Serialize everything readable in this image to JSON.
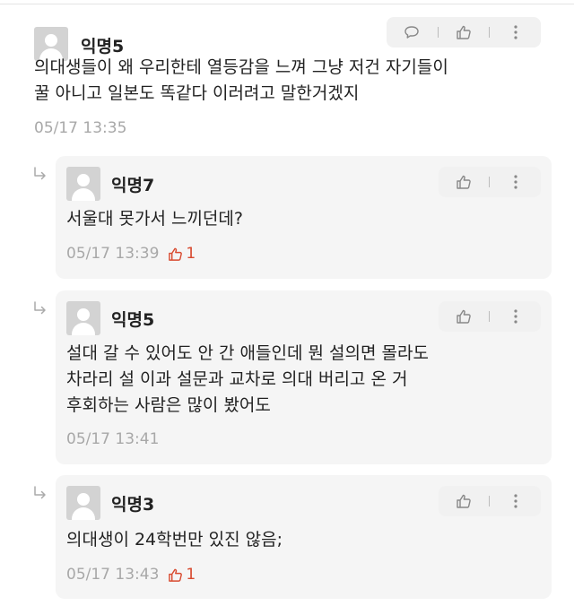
{
  "comment": {
    "author": "익명5",
    "lines": [
      "의대생들이 왜 우리한테 열등감을 느껴 그냥 저건 자기들이",
      "꿀 아니고 일본도 똑같다 이러려고 말한거겠지"
    ],
    "timestamp": "05/17 13:35"
  },
  "replies": [
    {
      "author": "익명7",
      "lines": [
        "서울대 못가서 느끼던데?"
      ],
      "timestamp": "05/17 13:39",
      "likes": "1"
    },
    {
      "author": "익명5",
      "lines": [
        "설대 갈 수 있어도 안 간 애들인데 뭔 설의면 몰라도",
        "차라리 설 이과 설문과 교차로 의대 버리고 온 거",
        "후회하는 사람은 많이 봤어도"
      ],
      "timestamp": "05/17 13:41"
    },
    {
      "author": "익명3",
      "lines": [
        "의대생이 24학번만 있진 않음;"
      ],
      "timestamp": "05/17 13:43",
      "likes": "1"
    }
  ],
  "icons": {
    "comment": "speech-bubble-icon",
    "like": "thumbs-up-icon",
    "more": "vertical-dots-icon",
    "reply": "reply-arrow-icon",
    "avatar": "anonymous-user-icon"
  },
  "colors": {
    "like_accent": "#d84a2f",
    "meta_gray": "#a8a8a8",
    "reply_bg": "#f5f5f5"
  }
}
